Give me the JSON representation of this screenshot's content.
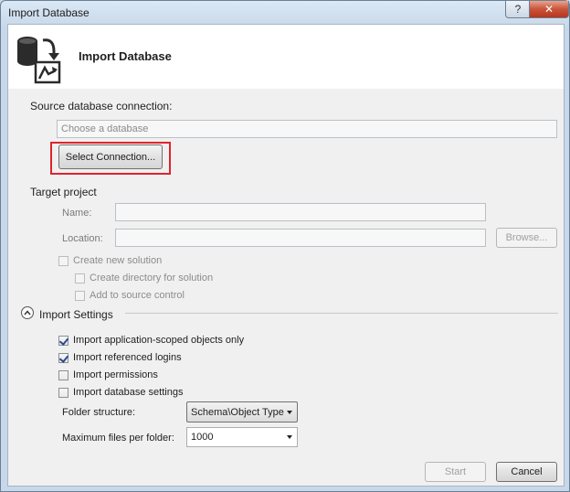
{
  "window": {
    "title": "Import Database",
    "help_glyph": "?",
    "close_glyph": "✕"
  },
  "header": {
    "title": "Import Database",
    "icon": "database-import-icon"
  },
  "source": {
    "section_label": "Source database connection:",
    "placeholder": "Choose a database",
    "select_button": "Select Connection..."
  },
  "target": {
    "section_label": "Target project",
    "name_label": "Name:",
    "name_value": "",
    "location_label": "Location:",
    "location_value": "",
    "browse_button": "Browse...",
    "create_solution": {
      "label": "Create new solution",
      "checked": false,
      "enabled": false
    },
    "create_directory": {
      "label": "Create directory for solution",
      "checked": false,
      "enabled": false
    },
    "source_control": {
      "label": "Add to source control",
      "checked": false,
      "enabled": false
    }
  },
  "import_settings": {
    "section_label": "Import Settings",
    "options": [
      {
        "label": "Import application-scoped objects only",
        "checked": true
      },
      {
        "label": "Import referenced logins",
        "checked": true
      },
      {
        "label": "Import permissions",
        "checked": false
      },
      {
        "label": "Import database settings",
        "checked": false
      }
    ],
    "folder_structure_label": "Folder structure:",
    "folder_structure_value": "Schema\\Object Type",
    "max_files_label": "Maximum files per folder:",
    "max_files_value": "1000"
  },
  "footer": {
    "start_button": "Start",
    "cancel_button": "Cancel"
  },
  "colors": {
    "highlight": "#e0232e",
    "close_button": "#c8543a",
    "checkmark": "#2a4b8d"
  }
}
